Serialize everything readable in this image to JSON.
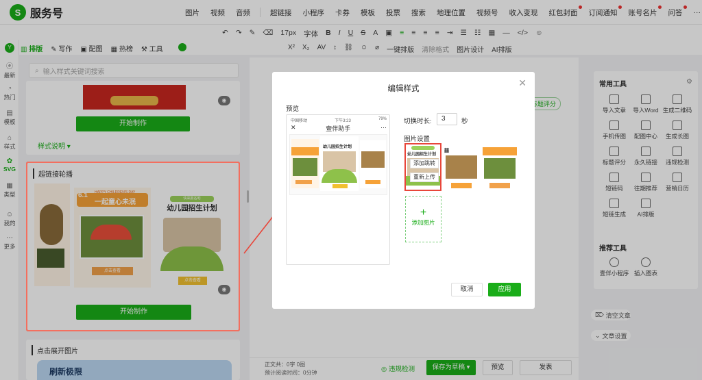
{
  "app": {
    "name": "服务号"
  },
  "topmenu": [
    "图片",
    "视频",
    "音频",
    "超链接",
    "小程序",
    "卡券",
    "模板",
    "投票",
    "搜索",
    "地理位置",
    "视频号",
    "收入变现",
    "红包封面",
    "订阅通知",
    "账号名片",
    "问答",
    "···"
  ],
  "toolbar": {
    "font_size": "17px",
    "font": "字体",
    "one_click": "一键排版",
    "clear_format": "清除格式",
    "image_design": "图片设计",
    "ai_layout": "AI排版"
  },
  "subtabs": [
    "排版",
    "写作",
    "配图",
    "热榜",
    "工具"
  ],
  "leftnav": [
    {
      "icon": "ⓔ",
      "label": "最新"
    },
    {
      "icon": "◔",
      "label": "热门"
    },
    {
      "icon": "▤",
      "label": "模板"
    },
    {
      "icon": "⌂",
      "label": "样式"
    },
    {
      "icon": "✿",
      "label": "SVG"
    },
    {
      "icon": "▦",
      "label": "类型"
    },
    {
      "icon": "☺",
      "label": "我的"
    },
    {
      "icon": "⋯",
      "label": "更多"
    }
  ],
  "search": {
    "placeholder": "输入样式关键词搜索"
  },
  "card1": {
    "button": "开始制作",
    "tip": "样式说明 ▾"
  },
  "card2": {
    "title": "超链接轮播",
    "button": "开始制作",
    "banner1_sub": "HAPPY CHILDREN'S DAY",
    "banner1_date": "6.1",
    "banner1_title": "一起童心未泯",
    "banner2_title": "幼儿园招生计划",
    "banner2_sub": "快来报名吧",
    "cta": "点击查看"
  },
  "card3": {
    "title": "点击展开图片",
    "banner": "刷新极限"
  },
  "editor": {
    "score": "标题评分"
  },
  "modal": {
    "title": "编辑样式",
    "preview_label": "预览",
    "phone_status_left": "中国移动",
    "phone_time": "下午3:23",
    "phone_battery": "79%",
    "phone_title": "壹伴助手",
    "duration_label": "切换时长:",
    "duration_value": "3",
    "duration_unit": "秒",
    "image_settings": "图片设置",
    "add_jump": "添加跳转",
    "re_upload": "重新上传",
    "add_image": "添加图片",
    "cancel": "取消",
    "ok": "应用"
  },
  "rightpanel": {
    "title1": "常用工具",
    "tools": [
      "导入文章",
      "导入Word",
      "生成二维码",
      "手机传图",
      "配图中心",
      "生成长图",
      "标题评分",
      "永久链接",
      "违规检测",
      "短链码",
      "往期推荐",
      "营销日历",
      "短链生成",
      "AI排版"
    ],
    "title2": "推荐工具",
    "rec": [
      "壹伴小程序",
      "插入图表"
    ]
  },
  "sidebtns": [
    "清空文章",
    "文章设置"
  ],
  "bottombar": {
    "stats1": "正文共：0字 0图",
    "stats2": "预计阅读时间：0分钟",
    "check": "违规检测",
    "save": "保存为草稿",
    "preview": "预览",
    "publish": "发表"
  },
  "colors": {
    "accent": "#1aad19",
    "highlight": "#e8463a"
  }
}
